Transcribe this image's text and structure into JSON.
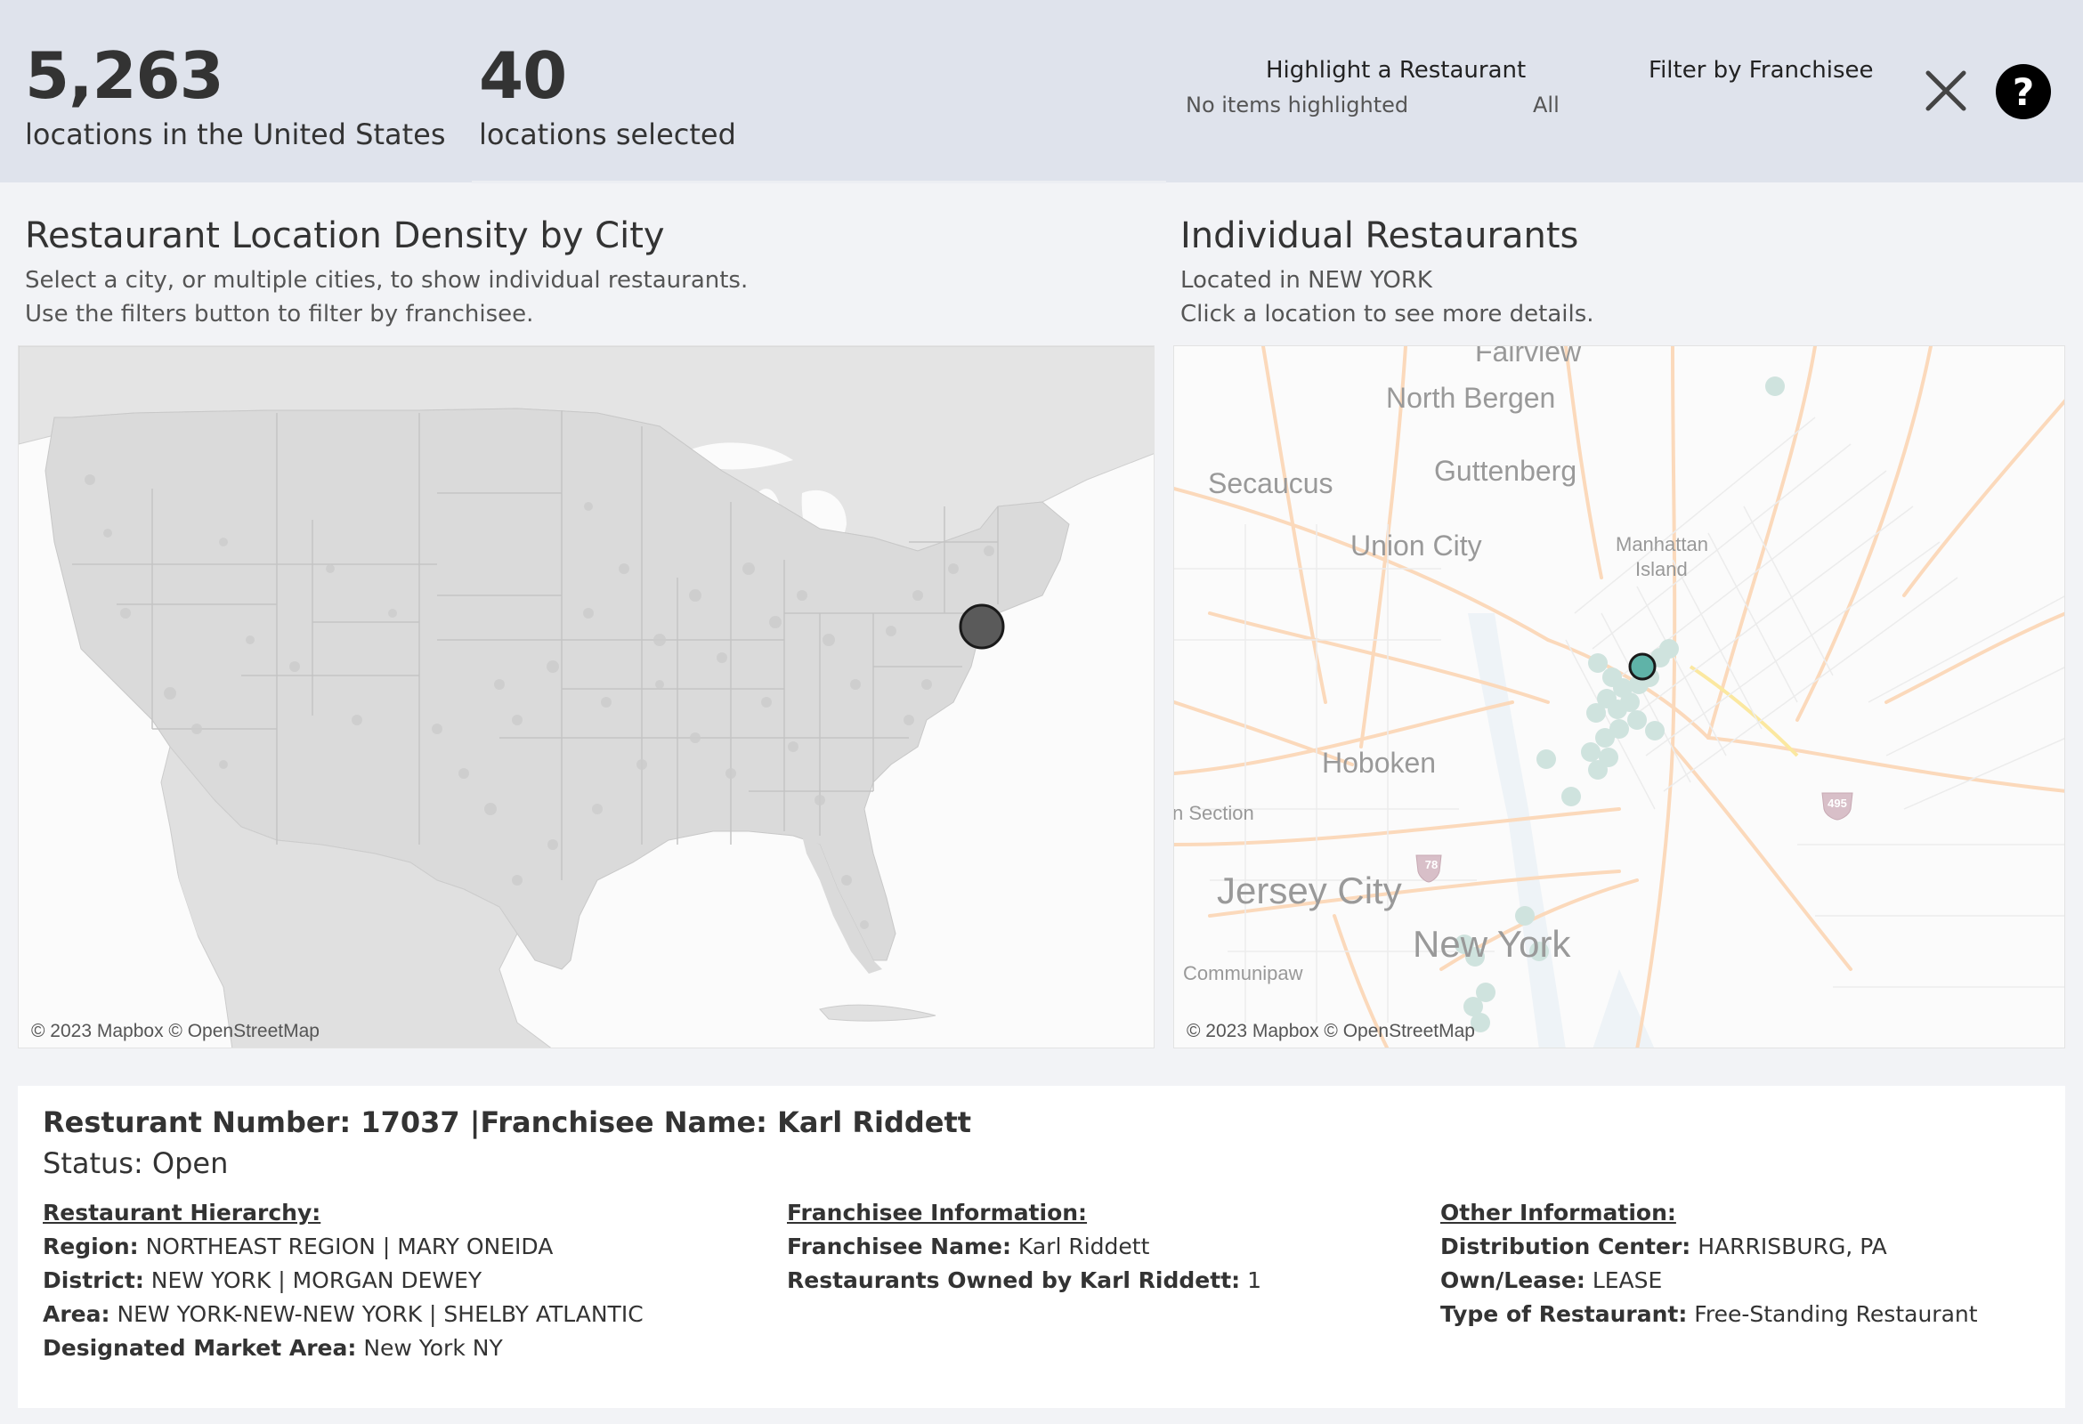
{
  "kpis": {
    "total_value": "5,263",
    "total_label": "locations in the United States",
    "selected_value": "40",
    "selected_label": "locations selected"
  },
  "filters": {
    "highlight_title": "Highlight a Restaurant",
    "highlight_value": "No items highlighted",
    "highlight_all": "All",
    "franchisee_title": "Filter by Franchisee"
  },
  "icons": {
    "close": "close-icon",
    "help": "help-icon"
  },
  "density": {
    "title": "Restaurant Location Density by City",
    "sub1": "Select a city, or multiple cities, to show individual restaurants.",
    "sub2": "Use the filters button to filter by franchisee.",
    "credit": "© 2023 Mapbox © OpenStreetMap"
  },
  "individual": {
    "title": "Individual Restaurants",
    "sub1": "Located in NEW YORK",
    "sub2": "Click a location to see more details.",
    "credit": "© 2023 Mapbox © OpenStreetMap",
    "places": {
      "fairview": "Fairview",
      "north_bergen": "North Bergen",
      "secaucus": "Secaucus",
      "guttenberg": "Guttenberg",
      "union_city": "Union City",
      "manhattan_1": "Manhattan",
      "manhattan_2": "Island",
      "hoboken": "Hoboken",
      "section": "n Section",
      "jersey_city": "Jersey City",
      "new_york": "New York",
      "communipaw": "Communipaw",
      "shield_78": "78",
      "shield_495": "495"
    }
  },
  "details": {
    "header": "Resturant Number: 17037 |Franchisee Name: Karl Riddett",
    "status": "Status: Open",
    "hierarchy": {
      "heading": "Restaurant Hierarchy:",
      "region_label": "Region:",
      "region_value": "NORTHEAST REGION | MARY ONEIDA",
      "district_label": "District:",
      "district_value": "NEW YORK | MORGAN DEWEY",
      "area_label": "Area:",
      "area_value": "NEW YORK-NEW-NEW YORK | SHELBY ATLANTIC",
      "dma_label": "Designated Market Area:",
      "dma_value": "New York NY"
    },
    "franchisee": {
      "heading": "Franchisee Information:",
      "name_label": "Franchisee Name:",
      "name_value": "Karl Riddett",
      "owned_label": "Restaurants Owned by Karl Riddett:",
      "owned_value": "1"
    },
    "other": {
      "heading": "Other Information:",
      "dc_label": "Distribution Center:",
      "dc_value": "HARRISBURG, PA",
      "own_label": "Own/Lease:",
      "own_value": "LEASE",
      "type_label": "Type of Restaurant:",
      "type_value": "Free-Standing Restaurant"
    }
  },
  "colors": {
    "header_bg": "#dfe3ec",
    "selected_marker": "#5a5a5a",
    "restaurant_marker": "#5fb3a8",
    "restaurant_faded": "#cfe3de"
  }
}
